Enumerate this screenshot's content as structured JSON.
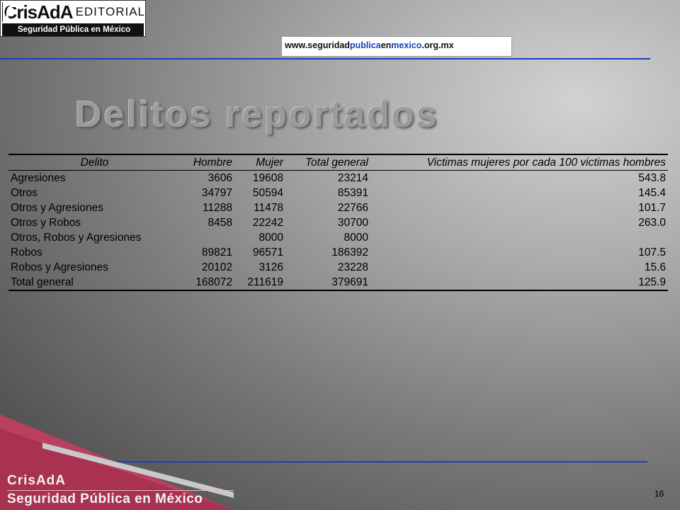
{
  "logo": {
    "name": "CrisAdA",
    "editorial": "EDITORIAL",
    "subtitle": "Seguridad Pública en México"
  },
  "url": {
    "part1": "www.seguridad",
    "part2": "publica",
    "part3": "en",
    "part4": "mexico",
    "part5": ".org.mx",
    "colors": {
      "dark": "#111111",
      "blue": "#1a3fbf"
    }
  },
  "slide": {
    "title": "Delitos reportados",
    "page_number": "16"
  },
  "table": {
    "headers": [
      "Delito",
      "Hombre",
      "Mujer",
      "Total general",
      "Victimas mujeres por cada 100 victimas hombres"
    ],
    "rows": [
      [
        "Agresiones",
        "3606",
        "19608",
        "23214",
        "543.8"
      ],
      [
        "Otros",
        "34797",
        "50594",
        "85391",
        "145.4"
      ],
      [
        "Otros y Agresiones",
        "11288",
        "11478",
        "22766",
        "101.7"
      ],
      [
        "Otros y Robos",
        "8458",
        "22242",
        "30700",
        "263.0"
      ],
      [
        "Otros, Robos y Agresiones",
        "",
        "8000",
        "8000",
        ""
      ],
      [
        "Robos",
        "89821",
        "96571",
        "186392",
        "107.5"
      ],
      [
        "Robos y Agresiones",
        "20102",
        "3126",
        "23228",
        "15.6"
      ],
      [
        "Total general",
        "168072",
        "211619",
        "379691",
        "125.9"
      ]
    ]
  },
  "footer": {
    "brand": "CrisAdA",
    "subtitle": "Seguridad Pública en México",
    "accent_color": "#b03060"
  }
}
